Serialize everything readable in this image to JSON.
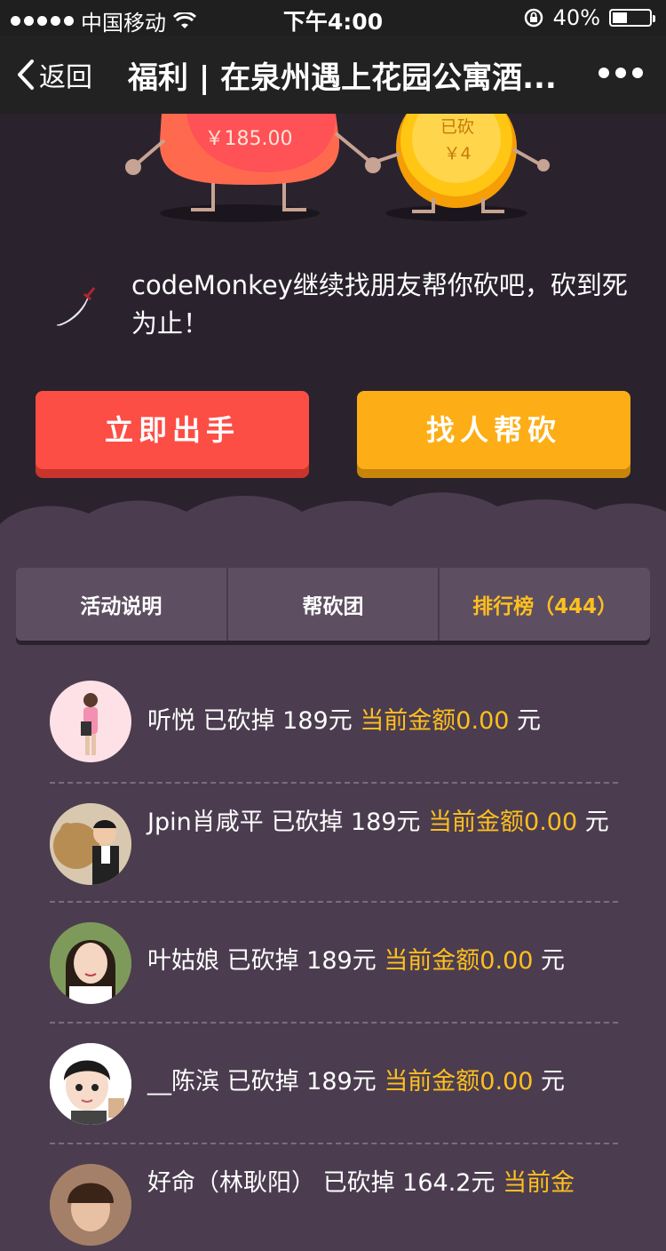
{
  "status_bar": {
    "carrier": "中国移动",
    "time": "下午4:00",
    "battery": "40%"
  },
  "nav": {
    "back_label": "返回",
    "title": "福利 | 在泉州遇上花园公寓酒..."
  },
  "hero": {
    "price": "￥185.00",
    "cut_label": "已砍",
    "cut_value": "￥4"
  },
  "message": "codeMonkey继续找朋友帮你砍吧，砍到死为止！",
  "buttons": {
    "buy_now": "立即出手",
    "find_help": "找人帮砍"
  },
  "tabs": [
    {
      "label": "活动说明"
    },
    {
      "label": "帮砍团"
    },
    {
      "label": "排行榜（444）"
    }
  ],
  "colors": {
    "accent_yellow": "#ffbf1f",
    "button_red": "#fc4e45",
    "button_yellow": "#fdae16",
    "background": "#4b3d4f"
  },
  "entries": [
    {
      "name": "听悦",
      "action": "已砍掉 189元",
      "amount": "当前金额0.00",
      "unit": "元"
    },
    {
      "name": "Jpin肖咸平",
      "action": "已砍掉 189元",
      "amount": "当前金额0.00",
      "unit": "元"
    },
    {
      "name": "叶姑娘",
      "action": "已砍掉 189元",
      "amount": "当前金额0.00",
      "unit": "元"
    },
    {
      "name": "__陈滨",
      "action": "已砍掉 189元",
      "amount": "当前金额0.00",
      "unit": "元"
    },
    {
      "name": "好命（林耿阳）",
      "action": "已砍掉 164.2元",
      "amount": "当前金",
      "unit": ""
    }
  ]
}
